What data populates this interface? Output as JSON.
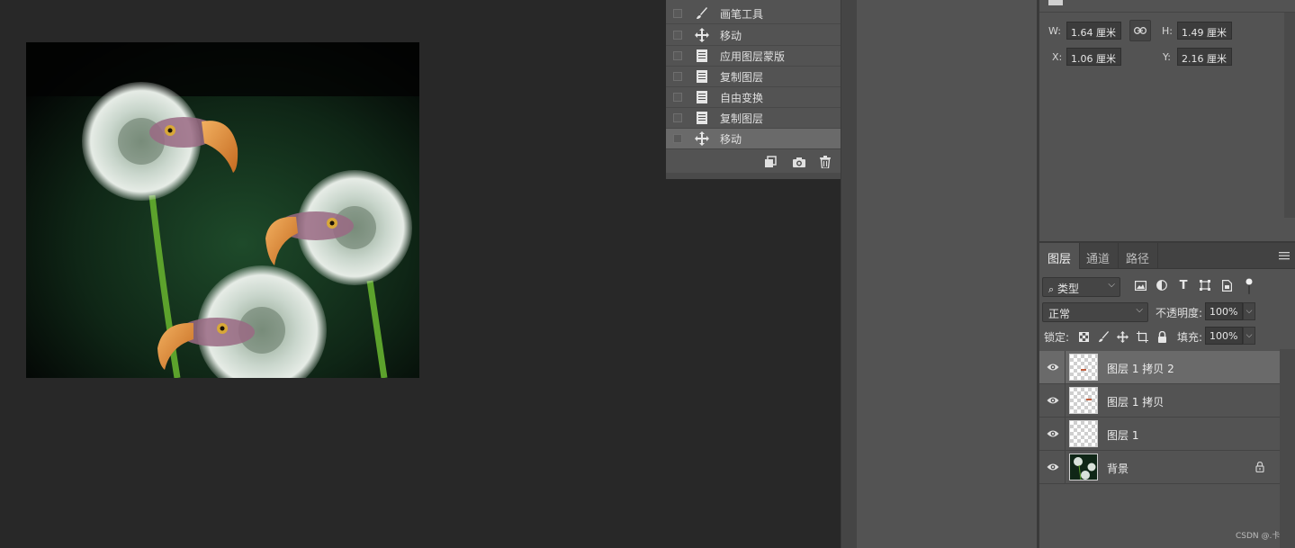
{
  "history": {
    "items": [
      {
        "label": "画笔工具",
        "icon": "brush-icon",
        "selected": false
      },
      {
        "label": "移动",
        "icon": "move-icon",
        "selected": false
      },
      {
        "label": "应用图层蒙版",
        "icon": "document-icon",
        "selected": false
      },
      {
        "label": "复制图层",
        "icon": "document-icon",
        "selected": false
      },
      {
        "label": "自由变换",
        "icon": "document-icon",
        "selected": false
      },
      {
        "label": "复制图层",
        "icon": "document-icon",
        "selected": false
      },
      {
        "label": "移动",
        "icon": "move-icon",
        "selected": true
      }
    ],
    "footer_icons": [
      "new-document-from-state-icon",
      "camera-icon",
      "trash-icon"
    ]
  },
  "properties": {
    "w_label": "W:",
    "w_value": "1.64 厘米",
    "h_label": "H:",
    "h_value": "1.49 厘米",
    "x_label": "X:",
    "x_value": "1.06 厘米",
    "y_label": "Y:",
    "y_value": "2.16 厘米"
  },
  "layers_panel": {
    "tabs": [
      {
        "label": "图层",
        "active": true
      },
      {
        "label": "通道",
        "active": false
      },
      {
        "label": "路径",
        "active": false
      }
    ],
    "filter_label": "类型",
    "blend_mode": "正常",
    "opacity_label": "不透明度:",
    "opacity_value": "100%",
    "lock_label": "锁定:",
    "fill_label": "填充:",
    "fill_value": "100%",
    "layers": [
      {
        "name": "图层 1 拷贝 2",
        "selected": true,
        "locked": false,
        "thumb": "transparent"
      },
      {
        "name": "图层 1 拷贝",
        "selected": false,
        "locked": false,
        "thumb": "transparent"
      },
      {
        "name": "图层 1",
        "selected": false,
        "locked": false,
        "thumb": "transparent"
      },
      {
        "name": "背景",
        "selected": false,
        "locked": true,
        "thumb": "image"
      }
    ]
  },
  "watermark": "CSDN @.卡",
  "colors": {
    "panel_bg": "#535353",
    "canvas_bg": "#282828",
    "selected_row": "#6a6a6a"
  }
}
